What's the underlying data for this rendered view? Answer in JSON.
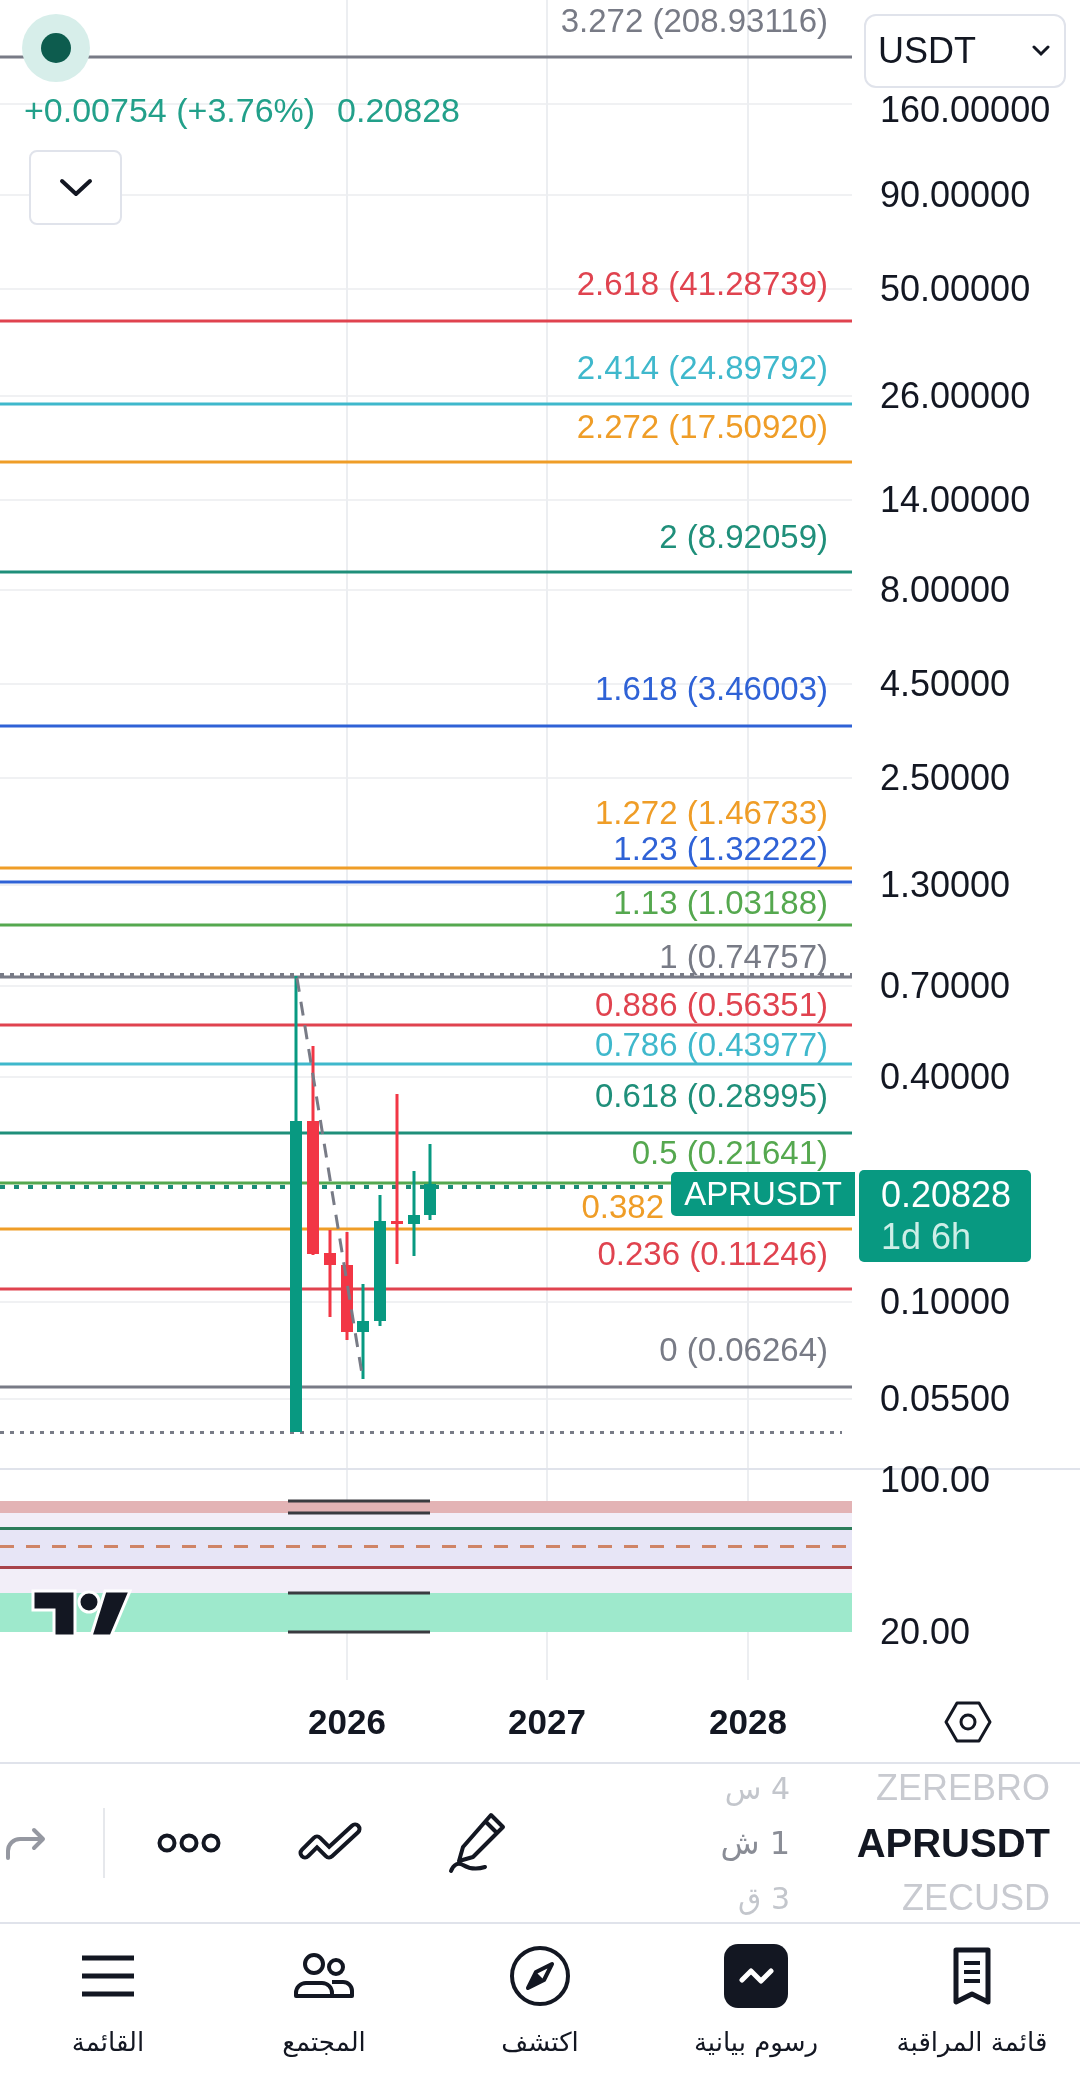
{
  "legend": {
    "change": "+0.00754 (+3.76%)",
    "price": "0.20828"
  },
  "currency_select": {
    "value": "USDT"
  },
  "fib_levels": [
    {
      "label": "3.272 (208.93116)",
      "color": "#787b86"
    },
    {
      "label": "2.618 (41.28739)",
      "color": "#e0434f"
    },
    {
      "label": "2.414 (24.89792)",
      "color": "#3fb8cc"
    },
    {
      "label": "2.272 (17.50920)",
      "color": "#ef9d27"
    },
    {
      "label": "2 (8.92059)",
      "color": "#1f8f7a"
    },
    {
      "label": "1.618 (3.46003)",
      "color": "#2f62d6"
    },
    {
      "label": "1.272 (1.46733)",
      "color": "#ef9d27"
    },
    {
      "label": "1.23 (1.32222)",
      "color": "#2f62d6"
    },
    {
      "label": "1.13 (1.03188)",
      "color": "#55a84f"
    },
    {
      "label": "1 (0.74757)",
      "color": "#787b86"
    },
    {
      "label": "0.886 (0.56351)",
      "color": "#e0434f"
    },
    {
      "label": "0.786 (0.43977)",
      "color": "#3fb8cc"
    },
    {
      "label": "0.618 (0.28995)",
      "color": "#1f8f7a"
    },
    {
      "label": "0.5 (0.21641)",
      "color": "#55a84f"
    },
    {
      "label": "0.382",
      "color": "#ef9d27"
    },
    {
      "label": "0.236 (0.11246)",
      "color": "#e0434f"
    },
    {
      "label": "0 (0.06264)",
      "color": "#787b86"
    }
  ],
  "symbol_tag": {
    "label": "APRUSDT"
  },
  "price_tag": {
    "price": "0.20828",
    "countdown": "1d 6h"
  },
  "price_axis": [
    "160.00000",
    "90.00000",
    "50.00000",
    "26.00000",
    "14.00000",
    "8.00000",
    "4.50000",
    "2.50000",
    "1.30000",
    "0.70000",
    "0.40000",
    "0.10000",
    "0.05500"
  ],
  "indicator_axis": [
    "100.00",
    "20.00"
  ],
  "time_axis": [
    "2026",
    "2027",
    "2028"
  ],
  "symbol_wheel": [
    {
      "interval": "4 س",
      "symbol": "ZEREBRO",
      "selected": false
    },
    {
      "interval": "1 ش",
      "symbol": "APRUSDT",
      "selected": true
    },
    {
      "interval": "3 ق",
      "symbol": "ZECUSD",
      "selected": false
    }
  ],
  "bottom_nav": [
    {
      "label": "قائمة المراقبة",
      "kind": "watchlist",
      "selected": false
    },
    {
      "label": "رسوم بيانية",
      "kind": "chart",
      "selected": true
    },
    {
      "label": "اكتشف",
      "kind": "explore",
      "selected": false
    },
    {
      "label": "المجتمع",
      "kind": "community",
      "selected": false
    },
    {
      "label": "القائمة",
      "kind": "menu",
      "selected": false
    }
  ]
}
